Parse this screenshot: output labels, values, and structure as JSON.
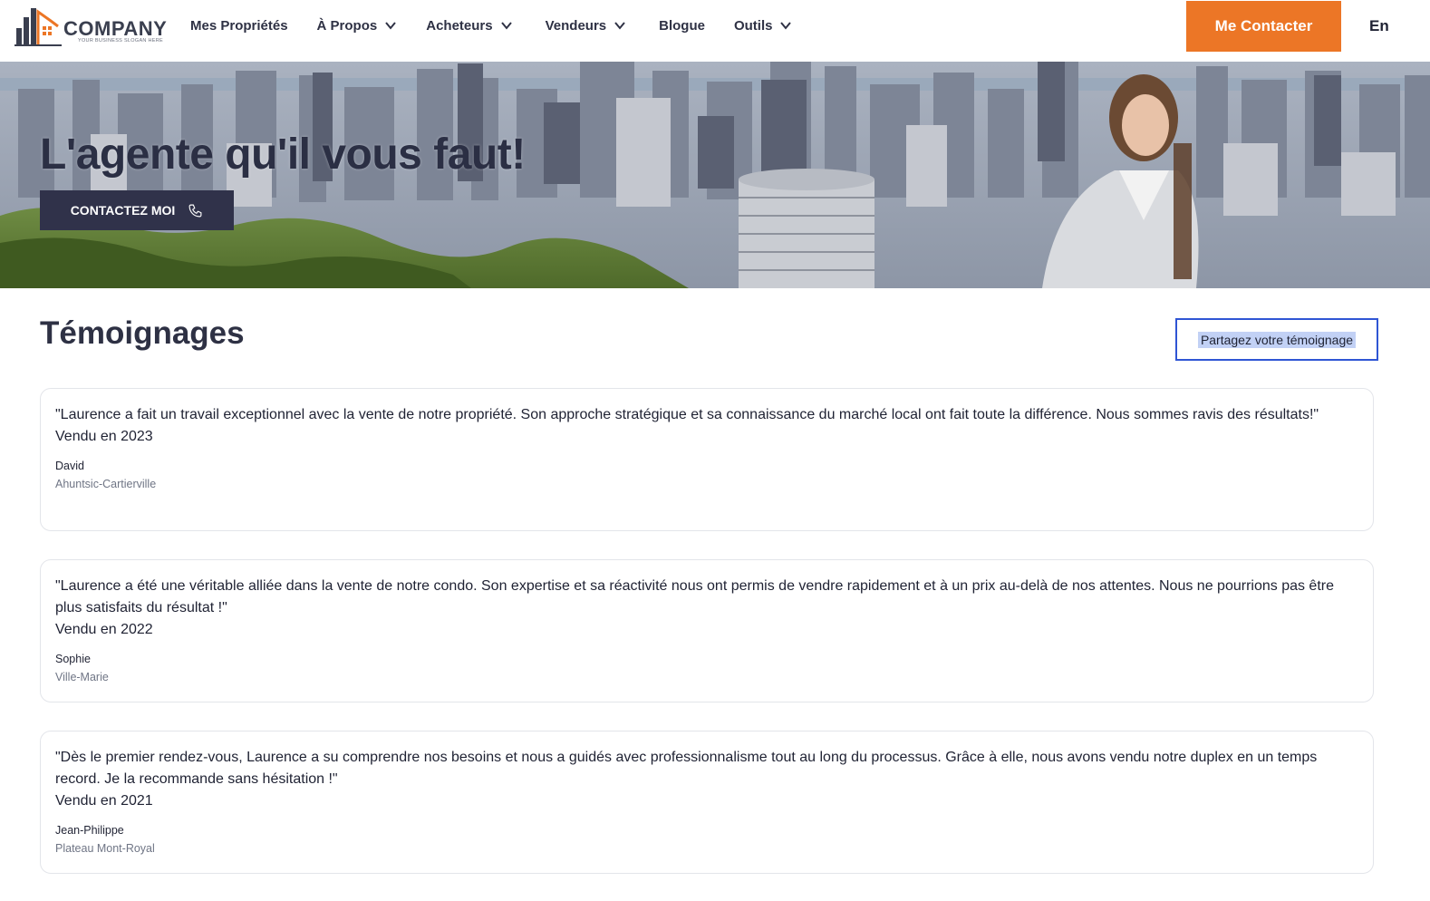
{
  "brand": {
    "name": "COMPANY",
    "slogan": "YOUR BUSINESS SLOGAN HERE",
    "accent_color": "#ec7626",
    "dark_color": "#30324a"
  },
  "nav": {
    "items": [
      {
        "label": "Mes Propriétés",
        "has_dropdown": false
      },
      {
        "label": "À Propos",
        "has_dropdown": true
      },
      {
        "label": "Acheteurs",
        "has_dropdown": true
      },
      {
        "label": "Vendeurs",
        "has_dropdown": true
      },
      {
        "label": "Blogue",
        "has_dropdown": false
      },
      {
        "label": "Outils",
        "has_dropdown": true
      }
    ],
    "contact_label": "Me Contacter",
    "language_label": "En"
  },
  "hero": {
    "title": "L'agente qu'il vous faut!",
    "button_label": "CONTACTEZ MOI"
  },
  "testimonials": {
    "title": "Témoignages",
    "share_label": "Partagez votre témoignage",
    "items": [
      {
        "quote": "\"Laurence a fait un travail exceptionnel avec la vente de notre propriété. Son approche stratégique et sa connaissance du marché local ont fait toute la différence. Nous sommes ravis des résultats!\"",
        "year": "Vendu en 2023",
        "author": "David",
        "place": "Ahuntsic-Cartierville"
      },
      {
        "quote": "\"Laurence a été une véritable alliée dans la vente de notre condo. Son expertise et sa réactivité nous ont permis de vendre rapidement et à un prix au-delà de nos attentes. Nous ne pourrions pas être plus satisfaits du résultat !\"",
        "year": "Vendu en 2022",
        "author": "Sophie",
        "place": "Ville-Marie"
      },
      {
        "quote": "\"Dès le premier rendez-vous, Laurence a su comprendre nos besoins et nous a guidés avec professionnalisme tout au long du processus. Grâce à elle, nous avons vendu notre duplex en un temps record. Je la recommande sans hésitation !\"",
        "year": "Vendu en 2021",
        "author": "Jean-Philippe",
        "place": "Plateau Mont-Royal"
      }
    ]
  }
}
